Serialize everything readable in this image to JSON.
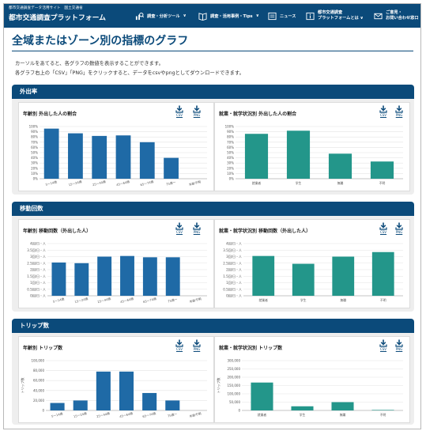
{
  "site": {
    "subtitle": "都市交通調査データ活用サイト　国土交通省",
    "name": "都市交通調査プラットフォーム"
  },
  "nav": [
    {
      "icon": "chart-search-icon",
      "lines": [
        "調査・分析ツール",
        "∨"
      ]
    },
    {
      "icon": "book-tips-icon",
      "lines": [
        "調査・活用事例・Tips",
        "∨"
      ]
    },
    {
      "icon": "news-icon",
      "lines": [
        "ニュース"
      ]
    },
    {
      "icon": "info-icon",
      "lines": [
        "都市交通調査",
        "プラットフォームとは ∨"
      ]
    },
    {
      "icon": "mail-icon",
      "lines": [
        "ご意見・",
        "お問い合わせ窓口"
      ]
    }
  ],
  "page": {
    "title": "全域またはゾーン別の指標のグラフ",
    "desc1": "カーソルをあてると、各グラフの数値を表示することができます。",
    "desc2": "各グラフ右上の「CSV」「PNG」をクリックすると、データをcsvやpngとしてダウンロードできます。"
  },
  "download": {
    "csv": "CSV",
    "png": "PNG"
  },
  "colors": {
    "brand": "#0b4a7a",
    "age_bar": "#1f6aa6",
    "occupation_bar": "#23968a"
  },
  "sections": [
    {
      "title": "外出率",
      "left_title": "年齢別 外出した人の割合",
      "right_title": "就業・就学状況別 外出した人の割合"
    },
    {
      "title": "移動回数",
      "left_title": "年齢別 移動回数（外出した人）",
      "right_title": "就業・就学状況別 移動回数（外出した人）"
    },
    {
      "title": "トリップ数",
      "left_title": "年齢別 トリップ数",
      "right_title": "就業・就学状況別 トリップ数"
    }
  ],
  "chart_data": [
    {
      "type": "bar",
      "categories": [
        "5〜14歳",
        "15〜24歳",
        "25〜44歳",
        "45〜64歳",
        "65〜74歳",
        "75歳〜",
        "年齢不明"
      ],
      "values": [
        96,
        87,
        82,
        83,
        70,
        40,
        0
      ],
      "ylim": [
        0,
        100
      ],
      "yticks": [
        "0%",
        "10%",
        "20%",
        "30%",
        "40%",
        "50%",
        "60%",
        "70%",
        "80%",
        "90%",
        "100%"
      ],
      "grid": true
    },
    {
      "type": "bar",
      "categories": [
        "就業者",
        "学生",
        "無職",
        "不明"
      ],
      "values": [
        86,
        92,
        48,
        33
      ],
      "ylim": [
        0,
        100
      ],
      "yticks": [
        "0%",
        "10%",
        "20%",
        "30%",
        "40%",
        "50%",
        "60%",
        "70%",
        "80%",
        "90%",
        "100%"
      ],
      "grid": true
    },
    {
      "type": "bar",
      "categories": [
        "5〜14歳",
        "15〜24歳",
        "25〜44歳",
        "45〜64歳",
        "65〜74歳",
        "75歳〜",
        "年齢不明"
      ],
      "values": [
        2.55,
        2.5,
        3.0,
        3.05,
        2.95,
        2.95,
        0
      ],
      "ylim": [
        0,
        4
      ],
      "yticks": [
        "0回/日・人",
        "0.5回/日・人",
        "1回/日・人",
        "1.5回/日・人",
        "2回/日・人",
        "2.5回/日・人",
        "3回/日・人",
        "3.5回/日・人",
        "4回/日・人"
      ],
      "grid": true
    },
    {
      "type": "bar",
      "categories": [
        "就業者",
        "学生",
        "無職",
        "不明"
      ],
      "values": [
        3.05,
        2.45,
        3.0,
        3.35
      ],
      "ylim": [
        0,
        4
      ],
      "yticks": [
        "0回/日・人",
        "0.5回/日・人",
        "1回/日・人",
        "1.5回/日・人",
        "2回/日・人",
        "2.5回/日・人",
        "3回/日・人",
        "3.5回/日・人",
        "4回/日・人"
      ],
      "grid": true
    },
    {
      "type": "bar",
      "categories": [
        "5〜14歳",
        "15〜24歳",
        "25〜44歳",
        "45〜64歳",
        "65〜74歳",
        "75歳〜",
        "年齢不明"
      ],
      "values": [
        15000,
        20000,
        78000,
        78000,
        35000,
        20000,
        0
      ],
      "ylim": [
        0,
        100000
      ],
      "yticks": [
        "0",
        "20,000",
        "40,000",
        "60,000",
        "80,000",
        "100,000"
      ],
      "ylabel": "トリップ数",
      "grid": true
    },
    {
      "type": "bar",
      "categories": [
        "就業者",
        "学生",
        "無職",
        "不明"
      ],
      "values": [
        168000,
        25000,
        50000,
        3000
      ],
      "ylim": [
        0,
        300000
      ],
      "yticks": [
        "0",
        "50,000",
        "100,000",
        "150,000",
        "200,000",
        "250,000",
        "300,000"
      ],
      "ylabel": "トリップ数",
      "grid": true
    }
  ]
}
